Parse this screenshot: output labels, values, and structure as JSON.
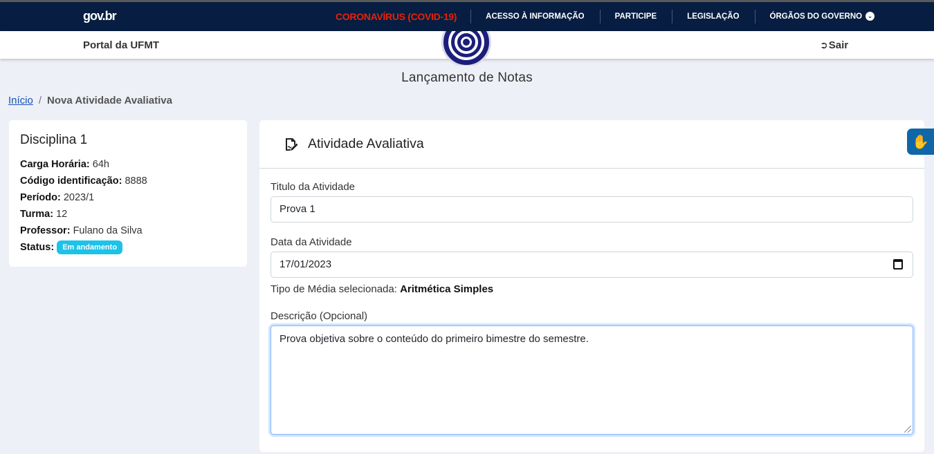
{
  "govbar": {
    "logo": "gov.br",
    "items": [
      {
        "label": "CORONAVÍRUS (COVID-19)"
      },
      {
        "label": "ACESSO À INFORMAÇÃO"
      },
      {
        "label": "PARTICIPE"
      },
      {
        "label": "LEGISLAÇÃO"
      },
      {
        "label": "ÓRGÃOS DO GOVERNO"
      }
    ],
    "covid_color": "#e52207",
    "background": "#071d41"
  },
  "header": {
    "portal": "Portal da UFMT",
    "logout": "Sair",
    "page_title": "Lançamento de Notas"
  },
  "breadcrumb": {
    "home": "Início",
    "separator": "/",
    "current": "Nova Atividade Avaliativa"
  },
  "discipline": {
    "name": "Disciplina 1",
    "fields": [
      {
        "label": "Carga Horária:",
        "value": "64h"
      },
      {
        "label": "Código identificação:",
        "value": "8888"
      },
      {
        "label": "Período:",
        "value": "2023/1"
      },
      {
        "label": "Turma:",
        "value": "12"
      },
      {
        "label": "Professor:",
        "value": "Fulano da Silva"
      }
    ],
    "status_label": "Status:",
    "status": "Em andamento",
    "status_color": "#1cc2e8"
  },
  "activity": {
    "heading": "Atividade Avaliativa",
    "title_label": "Titulo da Atividade",
    "title_value": "Prova 1",
    "date_label": "Data da Atividade",
    "date_value": "17/01/2023",
    "average_label": "Tipo de Média selecionada:",
    "average_value": "Aritmética Simples",
    "description_label": "Descrição (Opcional)",
    "description_value": "Prova objetiva sobre o conteúdo do primeiro bimestre do semestre."
  }
}
